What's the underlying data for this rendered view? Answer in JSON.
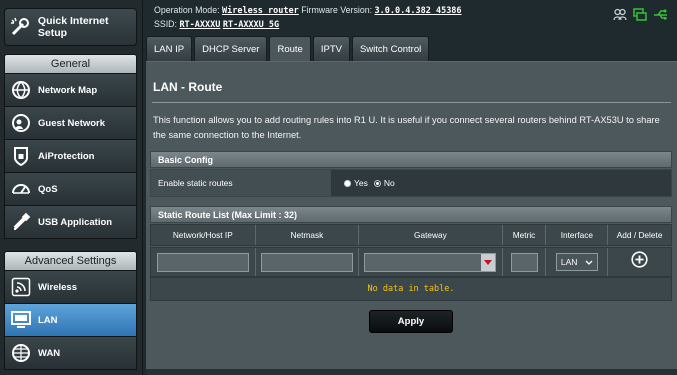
{
  "sidebar": {
    "quick_setup": "Quick Internet Setup",
    "general_label": "General",
    "general_items": [
      {
        "label": "Network Map",
        "icon": "globe-icon"
      },
      {
        "label": "Guest Network",
        "icon": "guest-network-icon"
      },
      {
        "label": "AiProtection",
        "icon": "lock-icon"
      },
      {
        "label": "QoS",
        "icon": "gauge-icon"
      },
      {
        "label": "USB Application",
        "icon": "usb-icon"
      }
    ],
    "advanced_label": "Advanced Settings",
    "advanced_items": [
      {
        "label": "Wireless",
        "icon": "wireless-icon"
      },
      {
        "label": "LAN",
        "icon": "lan-icon",
        "active": true
      },
      {
        "label": "WAN",
        "icon": "globe-wan-icon"
      }
    ]
  },
  "header": {
    "operation_mode_label": "Operation Mode:",
    "operation_mode_value": "Wireless router",
    "firmware_label": "Firmware Version:",
    "firmware_value": "3.0.0.4.382_45386",
    "ssid_label": "SSID:",
    "ssid_1": "RT-AXXXU",
    "ssid_2": "RT-AXXXU_5G"
  },
  "tabs": [
    {
      "label": "LAN IP"
    },
    {
      "label": "DHCP Server"
    },
    {
      "label": "Route",
      "active": true
    },
    {
      "label": "IPTV"
    },
    {
      "label": "Switch Control"
    }
  ],
  "main": {
    "title": "LAN - Route",
    "description": "This function allows you to add routing rules into R1        U. It is useful if you connect several routers behind RT-AX53U to share the same connection to the Internet.",
    "basic_config": {
      "header": "Basic Config",
      "enable_label": "Enable static routes",
      "yes_label": "Yes",
      "no_label": "No",
      "selected": "No"
    },
    "route_list": {
      "header": "Static Route List (Max Limit : 32)",
      "columns": [
        "Network/Host IP",
        "Netmask",
        "Gateway",
        "Metric",
        "Interface",
        "Add / Delete"
      ],
      "interface_value": "LAN",
      "empty_message": "No data in table."
    },
    "apply_label": "Apply"
  },
  "colors": {
    "active_menu": "#3f87c7",
    "empty_text": "#f5c21b",
    "status_green": "#34c534",
    "dropdown_red": "#c8102e"
  }
}
